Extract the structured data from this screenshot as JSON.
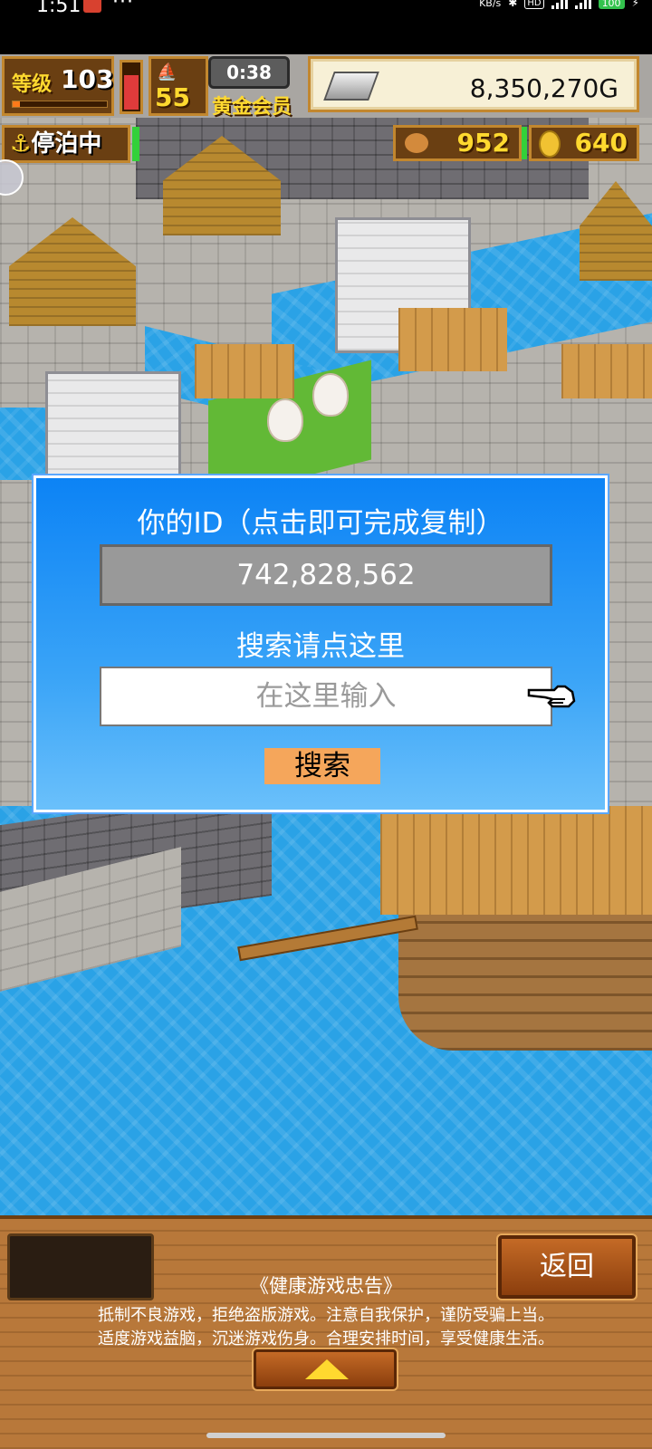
{
  "status_bar": {
    "time": "1:51",
    "dots": "···",
    "kbs": "KB/s",
    "hd": "HD",
    "battery": "100"
  },
  "hud": {
    "level_label": "等级",
    "level_value": "103",
    "level_progress": 0.08,
    "stamina_fraction": 0.7,
    "ship_value": "55",
    "timer": "0:38",
    "membership": "黄金会员",
    "money": "8,350,270G",
    "status": "停泊中",
    "food": "952",
    "medals": "640"
  },
  "dialog": {
    "title": "你的ID（点击即可完成复制）",
    "player_id": "742,828,562",
    "search_label": "搜索请点这里",
    "search_placeholder": "在这里输入",
    "search_button": "搜索"
  },
  "bottom": {
    "back_button": "返回",
    "advisory_title": "《健康游戏忠告》",
    "advisory_line1": "抵制不良游戏，拒绝盗版游戏。注意自我保护，谨防受骗上当。",
    "advisory_line2": "适度游戏益脑，沉迷游戏伤身。合理安排时间，享受健康生活。"
  },
  "colors": {
    "dialog_top": "#0c83f5",
    "search_button": "#f5a65b",
    "hud_wood": "#6a3f12",
    "gold_text": "#ffd92f"
  }
}
